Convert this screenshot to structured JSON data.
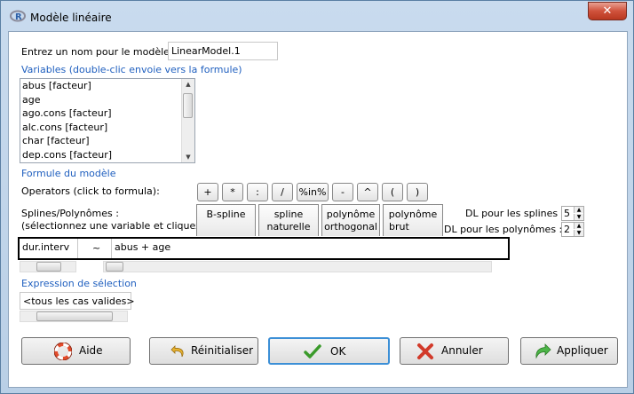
{
  "window": {
    "title": "Modèle linéaire",
    "close_glyph": "✕"
  },
  "model_name": {
    "label": "Entrez un nom pour le modèle",
    "value": "LinearModel.1"
  },
  "variables": {
    "label": "Variables (double-clic envoie vers la formule)",
    "items": [
      "abus [facteur]",
      "age",
      "ago.cons [facteur]",
      "alc.cons [facteur]",
      "char [facteur]",
      "dep.cons [facteur]"
    ]
  },
  "formula_section": {
    "label": "Formule du modèle"
  },
  "operators": {
    "label": "Operators (click to formula):",
    "buttons": [
      "+",
      "*",
      ":",
      "/",
      "%in%",
      "-",
      "^",
      "(",
      ")"
    ]
  },
  "splines": {
    "label_line1": "Splines/Polynômes :",
    "label_line2": "(sélectionnez une variable et cliquez)",
    "buttons": [
      {
        "line1": "B-spline",
        "line2": ""
      },
      {
        "line1": "spline",
        "line2": "naturelle"
      },
      {
        "line1": "polynôme",
        "line2": "orthogonal"
      },
      {
        "line1": "polynôme",
        "line2": "brut"
      }
    ],
    "df_splines_label": "DL pour les splines :",
    "df_splines_value": "5",
    "df_poly_label": "DL pour les polynômes :",
    "df_poly_value": "2"
  },
  "formula": {
    "lhs": "dur.interv",
    "tilde": "~",
    "rhs": "abus + age"
  },
  "subset": {
    "label": "Expression de sélection",
    "value": "<tous les cas valides>"
  },
  "buttons": {
    "help": "Aide",
    "reset": "Réinitialiser",
    "ok": "OK",
    "cancel": "Annuler",
    "apply": "Appliquer"
  },
  "colors": {
    "accent_text": "#1f5fbf",
    "ok_focus": "#3c8fd6"
  }
}
